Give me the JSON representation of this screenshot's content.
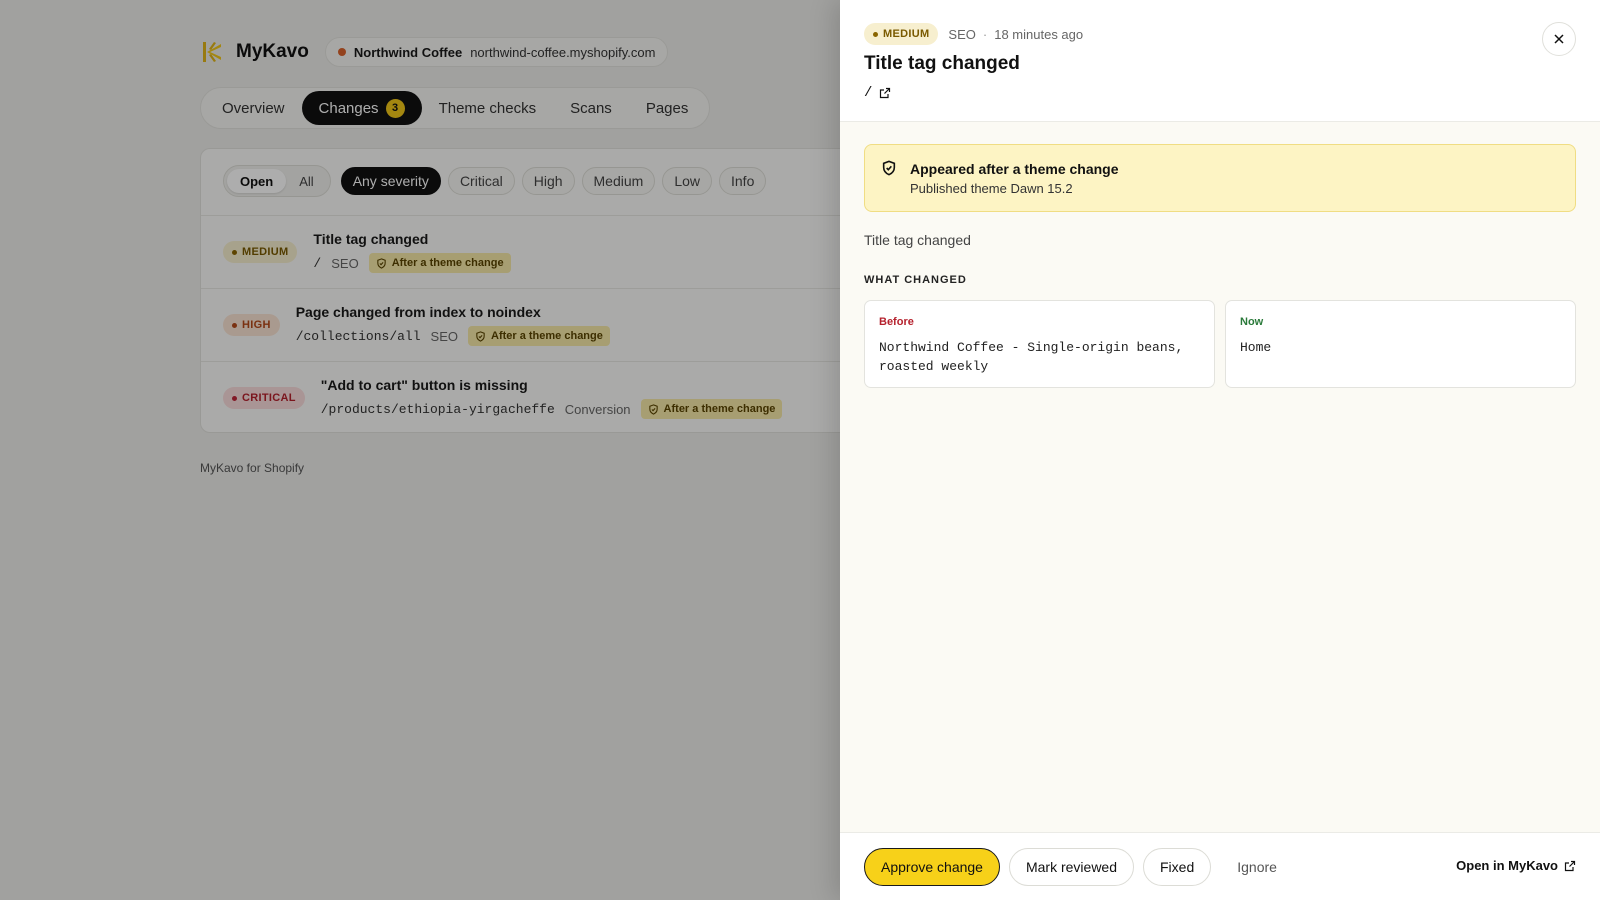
{
  "brand": {
    "name": "MyKavo",
    "logo_icon": "kavo-sun-logo"
  },
  "store": {
    "name": "Northwind Coffee",
    "url": "northwind-coffee.myshopify.com",
    "status_color": "#d9622b"
  },
  "tabs": [
    {
      "label": "Overview"
    },
    {
      "label": "Changes",
      "badge": "3"
    },
    {
      "label": "Theme checks"
    },
    {
      "label": "Scans"
    },
    {
      "label": "Pages"
    }
  ],
  "filters": {
    "status": [
      "Open",
      "All"
    ],
    "severity": [
      "Any severity",
      "Critical",
      "High",
      "Medium",
      "Low",
      "Info"
    ]
  },
  "changes": [
    {
      "severity": "MEDIUM",
      "title": "Title tag changed",
      "path": "/",
      "category": "SEO",
      "tag": "After a theme change"
    },
    {
      "severity": "HIGH",
      "title": "Page changed from index to noindex",
      "path": "/collections/all",
      "category": "SEO",
      "tag": "After a theme change"
    },
    {
      "severity": "CRITICAL",
      "title": "\"Add to cart\" button is missing",
      "path": "/products/ethiopia-yirgacheffe",
      "category": "Conversion",
      "tag": "After a theme change"
    }
  ],
  "footer": {
    "text": "MyKavo for Shopify"
  },
  "drawer": {
    "severity": "MEDIUM",
    "category": "SEO",
    "separator": "·",
    "time": "18 minutes ago",
    "title": "Title tag changed",
    "path": "/",
    "callout": {
      "title": "Appeared after a theme change",
      "subtitle": "Published theme Dawn 15.2"
    },
    "summary": "Title tag changed",
    "section_label": "WHAT CHANGED",
    "before": {
      "label": "Before",
      "value": "Northwind Coffee - Single-origin beans, roasted weekly"
    },
    "now": {
      "label": "Now",
      "value": "Home"
    },
    "actions": {
      "approve": "Approve change",
      "mark_reviewed": "Mark reviewed",
      "fixed": "Fixed",
      "ignore": "Ignore",
      "open_in": "Open in MyKavo"
    }
  },
  "colors": {
    "accent": "#f7d119",
    "critical": "#b5212d",
    "high": "#b4491a",
    "medium": "#7a5a00"
  }
}
